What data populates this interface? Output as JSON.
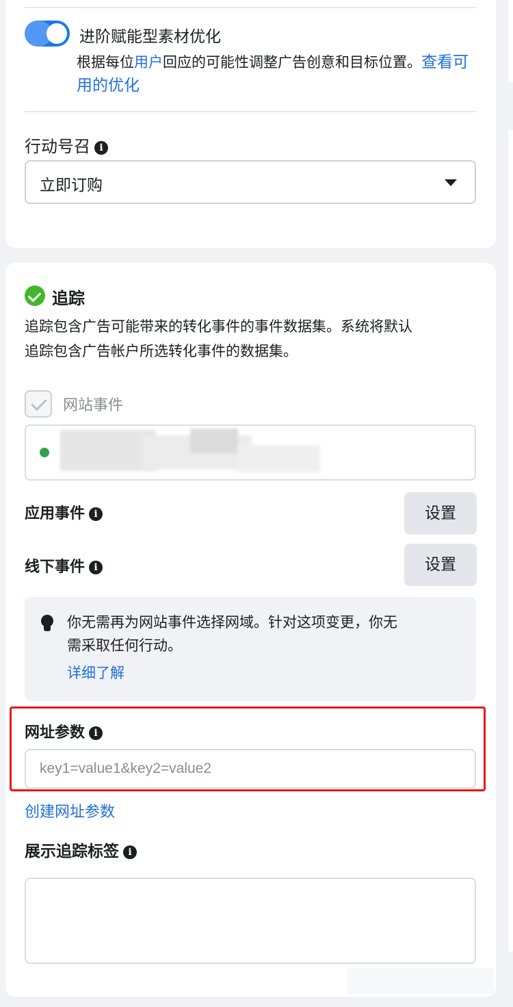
{
  "creative": {
    "toggle_label": "进阶赋能型素材优化",
    "toggle_desc_prefix": "根据每位",
    "toggle_desc_user": "用户",
    "toggle_desc_suffix": "回应的可能性调整广告创意和目标位置。",
    "toggle_link_line1": "查看可",
    "toggle_link_line2": "用的优化",
    "toggle_on": true
  },
  "cta": {
    "label": "行动号召",
    "selected": "立即订购"
  },
  "tracking": {
    "title": "追踪",
    "desc_line1": "追踪包含广告可能带来的转化事件的事件数据集。系统将默认",
    "desc_line2": "追踪包含广告帐户所选转化事件的数据集。",
    "website_events_label": "网站事件",
    "website_events_checked": true,
    "app_events_label": "应用事件",
    "offline_events_label": "线下事件",
    "setup_label": "设置",
    "notice_line1": "你无需再为网站事件选择网域。针对这项变更，你无",
    "notice_line2": "需采取任何行动。",
    "notice_link": "详细了解",
    "url_params_label": "网址参数",
    "url_params_placeholder": "key1=value1&key2=value2",
    "create_url_params_link": "创建网址参数",
    "display_tracking_label": "展示追踪标签",
    "display_tracking_value": ""
  }
}
